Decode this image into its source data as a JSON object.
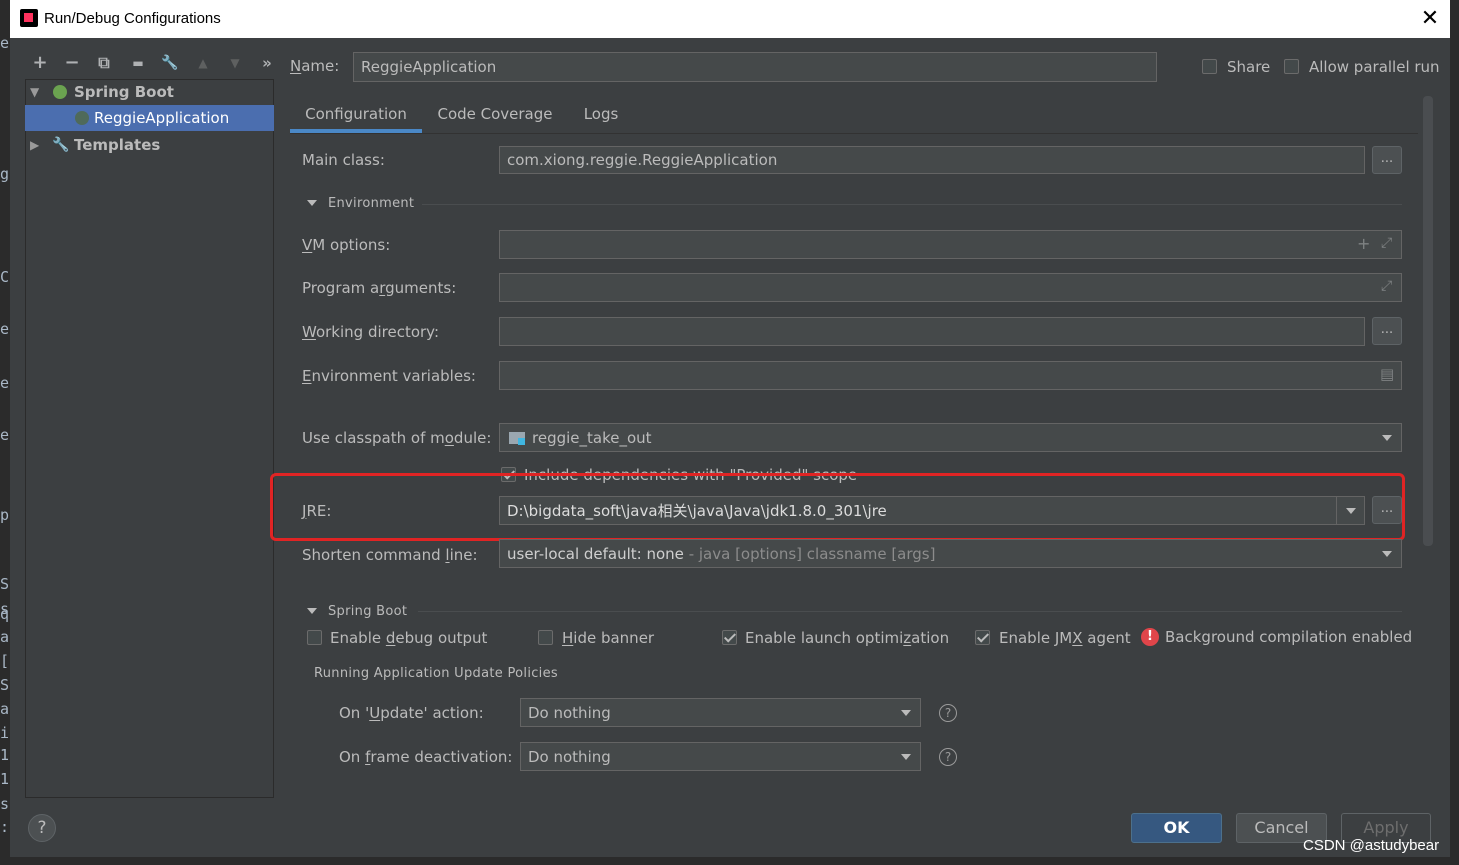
{
  "window": {
    "title": "Run/Debug Configurations",
    "close_glyph": "✕"
  },
  "background_letters": [
    "e",
    "gi",
    "C",
    "ec",
    "e",
    "el",
    "py",
    "S",
    "s",
    "q",
    "a",
    "[",
    "S",
    "a",
    "i",
    "1",
    "1",
    "s",
    ":"
  ],
  "toolbar": {
    "add": "+",
    "remove": "−",
    "copy": "⧉",
    "save": "▬",
    "edit": "🔧",
    "up": "▲",
    "down": "▼",
    "more": "»"
  },
  "tree": {
    "spring_boot": "Spring Boot",
    "reggie_app": "ReggieApplication",
    "templates": "Templates"
  },
  "name_row": {
    "label": "Name:",
    "value": "ReggieApplication"
  },
  "share": {
    "label": "Share",
    "checked": false
  },
  "allow_parallel": {
    "label": "Allow parallel run",
    "checked": false
  },
  "tabs": [
    {
      "label": "Configuration",
      "active": true
    },
    {
      "label": "Code Coverage",
      "active": false
    },
    {
      "label": "Logs",
      "active": false
    }
  ],
  "main_class": {
    "label": "Main class:",
    "value": "com.xiong.reggie.ReggieApplication"
  },
  "environment": {
    "title": "Environment",
    "vm_options": {
      "label": "VM options:",
      "value": ""
    },
    "program_args": {
      "label": "Program arguments:",
      "value": ""
    },
    "working_dir": {
      "label": "Working directory:",
      "value": ""
    },
    "env_vars": {
      "label": "Environment variables:",
      "value": ""
    }
  },
  "classpath": {
    "label": "Use classpath of module:",
    "value": "reggie_take_out"
  },
  "include_deps": {
    "label": "Include dependencies with \"Provided\" scope",
    "checked": true
  },
  "jre": {
    "label": "JRE:",
    "value": "D:\\bigdata_soft\\java相关\\java\\Java\\jdk1.8.0_301\\jre"
  },
  "shorten": {
    "label": "Shorten command line:",
    "value": "user-local default: none",
    "hint": " - java [options] classname [args]"
  },
  "spring_boot": {
    "title": "Spring Boot",
    "debug_output": {
      "label": "Enable debug output",
      "checked": false
    },
    "hide_banner": {
      "label": "Hide banner",
      "checked": false
    },
    "launch_opt": {
      "label": "Enable launch optimization",
      "checked": true
    },
    "jmx_agent": {
      "label": "Enable JMX agent",
      "checked": true
    },
    "bg_compile": "Background compilation enabled"
  },
  "policies": {
    "title": "Running Application Update Policies",
    "on_update": {
      "label": "On 'Update' action:",
      "value": "Do nothing"
    },
    "on_frame": {
      "label": "On frame deactivation:",
      "value": "Do nothing"
    }
  },
  "buttons": {
    "ok": "OK",
    "cancel": "Cancel",
    "apply": "Apply",
    "help": "?"
  },
  "watermark": "CSDN @astudybear",
  "colors": {
    "accent": "#4a88c7",
    "selection": "#4b6eaf",
    "highlight_box": "#e02424",
    "panel": "#3c3f41"
  }
}
